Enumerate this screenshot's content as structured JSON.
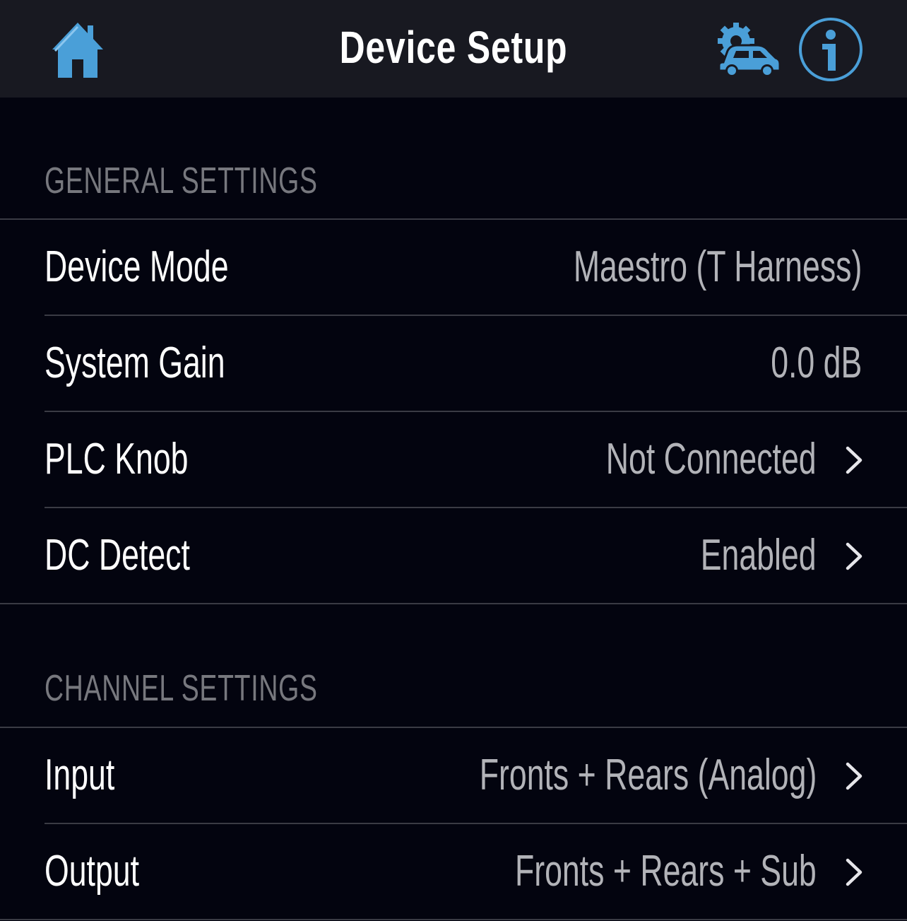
{
  "header": {
    "title": "Device Setup",
    "icons": {
      "home": "home-icon",
      "car_settings": "car-gear-icon",
      "info": "info-icon"
    },
    "accent_color": "#4a9fd8"
  },
  "sections": {
    "general": {
      "title": "GENERAL SETTINGS",
      "rows": [
        {
          "label": "Device Mode",
          "value": "Maestro (T Harness)"
        },
        {
          "label": "System Gain",
          "value": "0.0 dB"
        },
        {
          "label": "PLC Knob",
          "value": "Not Connected"
        },
        {
          "label": "DC Detect",
          "value": "Enabled"
        }
      ]
    },
    "channel": {
      "title": "CHANNEL SETTINGS",
      "rows": [
        {
          "label": "Input",
          "value": "Fronts + Rears (Analog)"
        },
        {
          "label": "Output",
          "value": "Fronts + Rears + Sub"
        }
      ]
    }
  }
}
